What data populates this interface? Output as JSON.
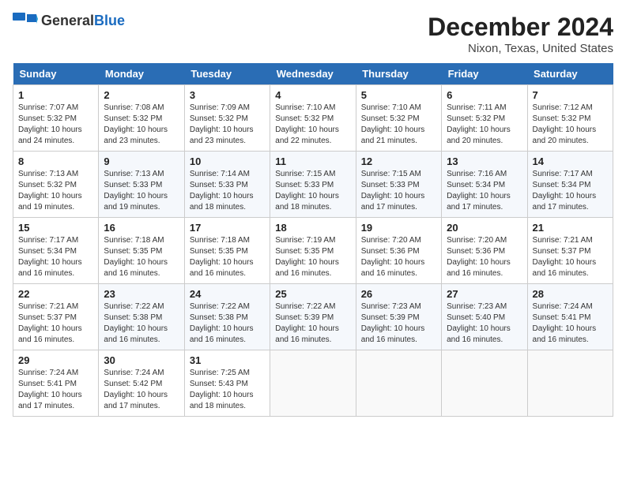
{
  "logo": {
    "line1": "General",
    "line2": "Blue"
  },
  "title": "December 2024",
  "subtitle": "Nixon, Texas, United States",
  "weekdays": [
    "Sunday",
    "Monday",
    "Tuesday",
    "Wednesday",
    "Thursday",
    "Friday",
    "Saturday"
  ],
  "weeks": [
    [
      {
        "day": "1",
        "sunrise": "Sunrise: 7:07 AM",
        "sunset": "Sunset: 5:32 PM",
        "daylight": "Daylight: 10 hours and 24 minutes."
      },
      {
        "day": "2",
        "sunrise": "Sunrise: 7:08 AM",
        "sunset": "Sunset: 5:32 PM",
        "daylight": "Daylight: 10 hours and 23 minutes."
      },
      {
        "day": "3",
        "sunrise": "Sunrise: 7:09 AM",
        "sunset": "Sunset: 5:32 PM",
        "daylight": "Daylight: 10 hours and 23 minutes."
      },
      {
        "day": "4",
        "sunrise": "Sunrise: 7:10 AM",
        "sunset": "Sunset: 5:32 PM",
        "daylight": "Daylight: 10 hours and 22 minutes."
      },
      {
        "day": "5",
        "sunrise": "Sunrise: 7:10 AM",
        "sunset": "Sunset: 5:32 PM",
        "daylight": "Daylight: 10 hours and 21 minutes."
      },
      {
        "day": "6",
        "sunrise": "Sunrise: 7:11 AM",
        "sunset": "Sunset: 5:32 PM",
        "daylight": "Daylight: 10 hours and 20 minutes."
      },
      {
        "day": "7",
        "sunrise": "Sunrise: 7:12 AM",
        "sunset": "Sunset: 5:32 PM",
        "daylight": "Daylight: 10 hours and 20 minutes."
      }
    ],
    [
      {
        "day": "8",
        "sunrise": "Sunrise: 7:13 AM",
        "sunset": "Sunset: 5:32 PM",
        "daylight": "Daylight: 10 hours and 19 minutes."
      },
      {
        "day": "9",
        "sunrise": "Sunrise: 7:13 AM",
        "sunset": "Sunset: 5:33 PM",
        "daylight": "Daylight: 10 hours and 19 minutes."
      },
      {
        "day": "10",
        "sunrise": "Sunrise: 7:14 AM",
        "sunset": "Sunset: 5:33 PM",
        "daylight": "Daylight: 10 hours and 18 minutes."
      },
      {
        "day": "11",
        "sunrise": "Sunrise: 7:15 AM",
        "sunset": "Sunset: 5:33 PM",
        "daylight": "Daylight: 10 hours and 18 minutes."
      },
      {
        "day": "12",
        "sunrise": "Sunrise: 7:15 AM",
        "sunset": "Sunset: 5:33 PM",
        "daylight": "Daylight: 10 hours and 17 minutes."
      },
      {
        "day": "13",
        "sunrise": "Sunrise: 7:16 AM",
        "sunset": "Sunset: 5:34 PM",
        "daylight": "Daylight: 10 hours and 17 minutes."
      },
      {
        "day": "14",
        "sunrise": "Sunrise: 7:17 AM",
        "sunset": "Sunset: 5:34 PM",
        "daylight": "Daylight: 10 hours and 17 minutes."
      }
    ],
    [
      {
        "day": "15",
        "sunrise": "Sunrise: 7:17 AM",
        "sunset": "Sunset: 5:34 PM",
        "daylight": "Daylight: 10 hours and 16 minutes."
      },
      {
        "day": "16",
        "sunrise": "Sunrise: 7:18 AM",
        "sunset": "Sunset: 5:35 PM",
        "daylight": "Daylight: 10 hours and 16 minutes."
      },
      {
        "day": "17",
        "sunrise": "Sunrise: 7:18 AM",
        "sunset": "Sunset: 5:35 PM",
        "daylight": "Daylight: 10 hours and 16 minutes."
      },
      {
        "day": "18",
        "sunrise": "Sunrise: 7:19 AM",
        "sunset": "Sunset: 5:35 PM",
        "daylight": "Daylight: 10 hours and 16 minutes."
      },
      {
        "day": "19",
        "sunrise": "Sunrise: 7:20 AM",
        "sunset": "Sunset: 5:36 PM",
        "daylight": "Daylight: 10 hours and 16 minutes."
      },
      {
        "day": "20",
        "sunrise": "Sunrise: 7:20 AM",
        "sunset": "Sunset: 5:36 PM",
        "daylight": "Daylight: 10 hours and 16 minutes."
      },
      {
        "day": "21",
        "sunrise": "Sunrise: 7:21 AM",
        "sunset": "Sunset: 5:37 PM",
        "daylight": "Daylight: 10 hours and 16 minutes."
      }
    ],
    [
      {
        "day": "22",
        "sunrise": "Sunrise: 7:21 AM",
        "sunset": "Sunset: 5:37 PM",
        "daylight": "Daylight: 10 hours and 16 minutes."
      },
      {
        "day": "23",
        "sunrise": "Sunrise: 7:22 AM",
        "sunset": "Sunset: 5:38 PM",
        "daylight": "Daylight: 10 hours and 16 minutes."
      },
      {
        "day": "24",
        "sunrise": "Sunrise: 7:22 AM",
        "sunset": "Sunset: 5:38 PM",
        "daylight": "Daylight: 10 hours and 16 minutes."
      },
      {
        "day": "25",
        "sunrise": "Sunrise: 7:22 AM",
        "sunset": "Sunset: 5:39 PM",
        "daylight": "Daylight: 10 hours and 16 minutes."
      },
      {
        "day": "26",
        "sunrise": "Sunrise: 7:23 AM",
        "sunset": "Sunset: 5:39 PM",
        "daylight": "Daylight: 10 hours and 16 minutes."
      },
      {
        "day": "27",
        "sunrise": "Sunrise: 7:23 AM",
        "sunset": "Sunset: 5:40 PM",
        "daylight": "Daylight: 10 hours and 16 minutes."
      },
      {
        "day": "28",
        "sunrise": "Sunrise: 7:24 AM",
        "sunset": "Sunset: 5:41 PM",
        "daylight": "Daylight: 10 hours and 16 minutes."
      }
    ],
    [
      {
        "day": "29",
        "sunrise": "Sunrise: 7:24 AM",
        "sunset": "Sunset: 5:41 PM",
        "daylight": "Daylight: 10 hours and 17 minutes."
      },
      {
        "day": "30",
        "sunrise": "Sunrise: 7:24 AM",
        "sunset": "Sunset: 5:42 PM",
        "daylight": "Daylight: 10 hours and 17 minutes."
      },
      {
        "day": "31",
        "sunrise": "Sunrise: 7:25 AM",
        "sunset": "Sunset: 5:43 PM",
        "daylight": "Daylight: 10 hours and 18 minutes."
      },
      null,
      null,
      null,
      null
    ]
  ]
}
